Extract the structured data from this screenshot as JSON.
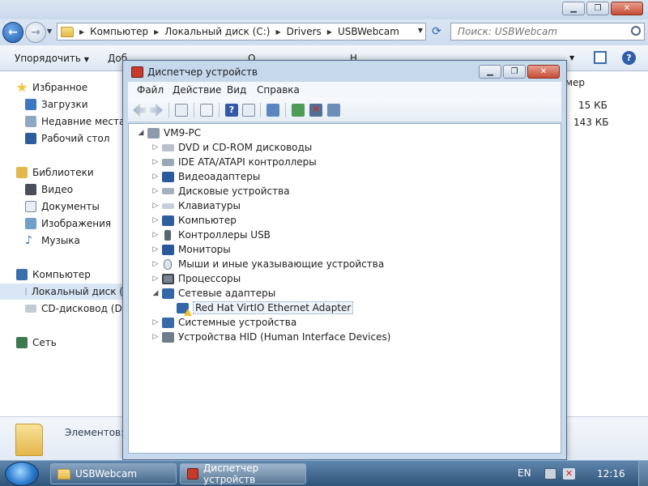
{
  "explorer": {
    "address": {
      "crumbs": [
        "Компьютер",
        "Локальный диск (C:)",
        "Drivers",
        "USBWebcam"
      ]
    },
    "search": {
      "placeholder": "Поиск: USBWebcam"
    },
    "commandbar": {
      "organize": "Упорядочить",
      "clipped_1": "Доб",
      "clipped_2": "О",
      "clipped_3": "Н"
    },
    "nav": {
      "favorites": "Избранное",
      "downloads": "Загрузки",
      "recent": "Недавние места",
      "desktop": "Рабочий стол",
      "libraries": "Библиотеки",
      "video": "Видео",
      "documents": "Документы",
      "images": "Изображения",
      "music": "Музыка",
      "computer": "Компьютер",
      "local_disk": "Локальный диск (",
      "cd_drive": "CD-дисковод (D:) ",
      "network": "Сеть"
    },
    "filepane": {
      "size_header_fragment": "мер",
      "size_1": "15 КБ",
      "size_2": "143 КБ"
    },
    "details": {
      "items_label": "Элементов:"
    }
  },
  "devmgr": {
    "title": "Диспетчер устройств",
    "menu": [
      "Файл",
      "Действие",
      "Вид",
      "Справка"
    ],
    "tree": {
      "root": "VM9-PC",
      "items": [
        "DVD и CD-ROM дисководы",
        "IDE ATA/ATAPI контроллеры",
        "Видеоадаптеры",
        "Дисковые устройства",
        "Клавиатуры",
        "Компьютер",
        "Контроллеры USB",
        "Мониторы",
        "Мыши и иные указывающие устройства",
        "Процессоры",
        "Сетевые адаптеры",
        "Системные устройства",
        "Устройства HID (Human Interface Devices)"
      ],
      "network_child": "Red Hat VirtIO Ethernet Adapter"
    }
  },
  "taskbar": {
    "tasks": [
      "USBWebcam",
      "Диспетчер устройств"
    ],
    "language": "EN",
    "clock": "12:16"
  },
  "colors": {
    "taskbar_top": "#5f86ad",
    "dialog_frame": "#c6d8ec",
    "warning": "#f2c12e"
  }
}
